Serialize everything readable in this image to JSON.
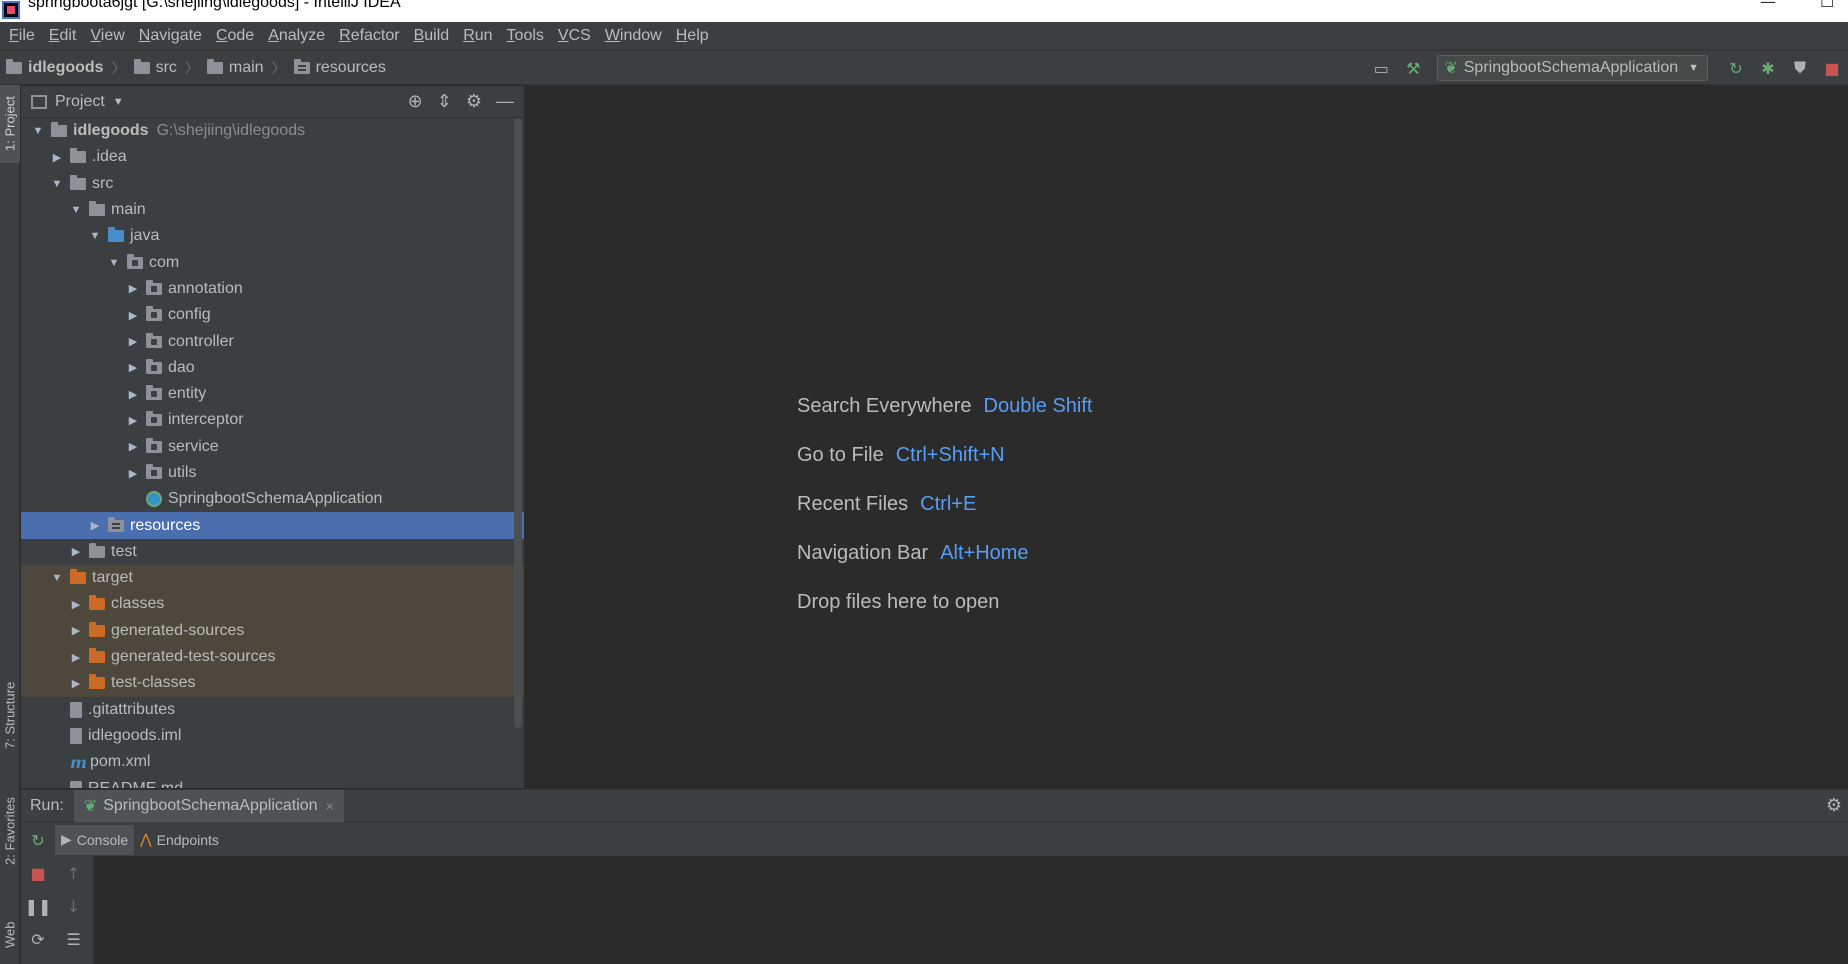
{
  "window": {
    "title": "springboota6jgt [G:\\shejiing\\idlegoods] - IntelliJ IDEA",
    "minimize": "—",
    "maximize": "☐"
  },
  "menu": [
    "File",
    "Edit",
    "View",
    "Navigate",
    "Code",
    "Analyze",
    "Refactor",
    "Build",
    "Run",
    "Tools",
    "VCS",
    "Window",
    "Help"
  ],
  "breadcrumb": [
    "idlegoods",
    "src",
    "main",
    "resources"
  ],
  "run_config": {
    "name": "SpringbootSchemaApplication"
  },
  "left_strip": {
    "project": "1: Project",
    "structure": "7: Structure",
    "favorites": "2: Favorites",
    "web": "Web"
  },
  "project_panel": {
    "title": "Project"
  },
  "tree": [
    {
      "label": "idlegoods",
      "path": "G:\\shejiing\\idlegoods",
      "depth": 0,
      "arrow": "▼",
      "icon": "module-folder",
      "bold": true
    },
    {
      "label": ".idea",
      "depth": 1,
      "arrow": "▶",
      "icon": "folder"
    },
    {
      "label": "src",
      "depth": 1,
      "arrow": "▼",
      "icon": "folder"
    },
    {
      "label": "main",
      "depth": 2,
      "arrow": "▼",
      "icon": "folder"
    },
    {
      "label": "java",
      "depth": 3,
      "arrow": "▼",
      "icon": "source-folder"
    },
    {
      "label": "com",
      "depth": 4,
      "arrow": "▼",
      "icon": "package"
    },
    {
      "label": "annotation",
      "depth": 5,
      "arrow": "▶",
      "icon": "package"
    },
    {
      "label": "config",
      "depth": 5,
      "arrow": "▶",
      "icon": "package"
    },
    {
      "label": "controller",
      "depth": 5,
      "arrow": "▶",
      "icon": "package"
    },
    {
      "label": "dao",
      "depth": 5,
      "arrow": "▶",
      "icon": "package"
    },
    {
      "label": "entity",
      "depth": 5,
      "arrow": "▶",
      "icon": "package"
    },
    {
      "label": "interceptor",
      "depth": 5,
      "arrow": "▶",
      "icon": "package"
    },
    {
      "label": "service",
      "depth": 5,
      "arrow": "▶",
      "icon": "package"
    },
    {
      "label": "utils",
      "depth": 5,
      "arrow": "▶",
      "icon": "package"
    },
    {
      "label": "SpringbootSchemaApplication",
      "depth": 5,
      "arrow": "",
      "icon": "spring-class"
    },
    {
      "label": "resources",
      "depth": 3,
      "arrow": "▶",
      "icon": "resources-folder",
      "selected": true
    },
    {
      "label": "test",
      "depth": 2,
      "arrow": "▶",
      "icon": "folder"
    },
    {
      "label": "target",
      "depth": 1,
      "arrow": "▼",
      "icon": "excluded-folder",
      "excluded": true
    },
    {
      "label": "classes",
      "depth": 2,
      "arrow": "▶",
      "icon": "excluded-folder",
      "excluded": true
    },
    {
      "label": "generated-sources",
      "depth": 2,
      "arrow": "▶",
      "icon": "excluded-folder",
      "excluded": true
    },
    {
      "label": "generated-test-sources",
      "depth": 2,
      "arrow": "▶",
      "icon": "excluded-folder",
      "excluded": true
    },
    {
      "label": "test-classes",
      "depth": 2,
      "arrow": "▶",
      "icon": "excluded-folder",
      "excluded": true
    },
    {
      "label": ".gitattributes",
      "depth": 1,
      "arrow": "",
      "icon": "file"
    },
    {
      "label": "idlegoods.iml",
      "depth": 1,
      "arrow": "",
      "icon": "file"
    },
    {
      "label": "pom.xml",
      "depth": 1,
      "arrow": "",
      "icon": "maven"
    },
    {
      "label": "README.md",
      "depth": 1,
      "arrow": "",
      "icon": "file"
    }
  ],
  "editor_hints": [
    {
      "action": "Search Everywhere",
      "shortcut": "Double Shift"
    },
    {
      "action": "Go to File",
      "shortcut": "Ctrl+Shift+N"
    },
    {
      "action": "Recent Files",
      "shortcut": "Ctrl+E"
    },
    {
      "action": "Navigation Bar",
      "shortcut": "Alt+Home"
    },
    {
      "action": "Drop files here to open",
      "shortcut": ""
    }
  ],
  "run_panel": {
    "label": "Run:",
    "tab": "SpringbootSchemaApplication",
    "close": "×",
    "subtabs": [
      "Console",
      "Endpoints"
    ]
  },
  "colors": {
    "selection": "#4b6eaf",
    "shortcut": "#589df6",
    "excluded_bg": "#4d483b",
    "excluded_folder": "#cc6b25",
    "source_folder": "#4a8ec9",
    "run_green": "#6aab73",
    "stop_red": "#c75450"
  }
}
